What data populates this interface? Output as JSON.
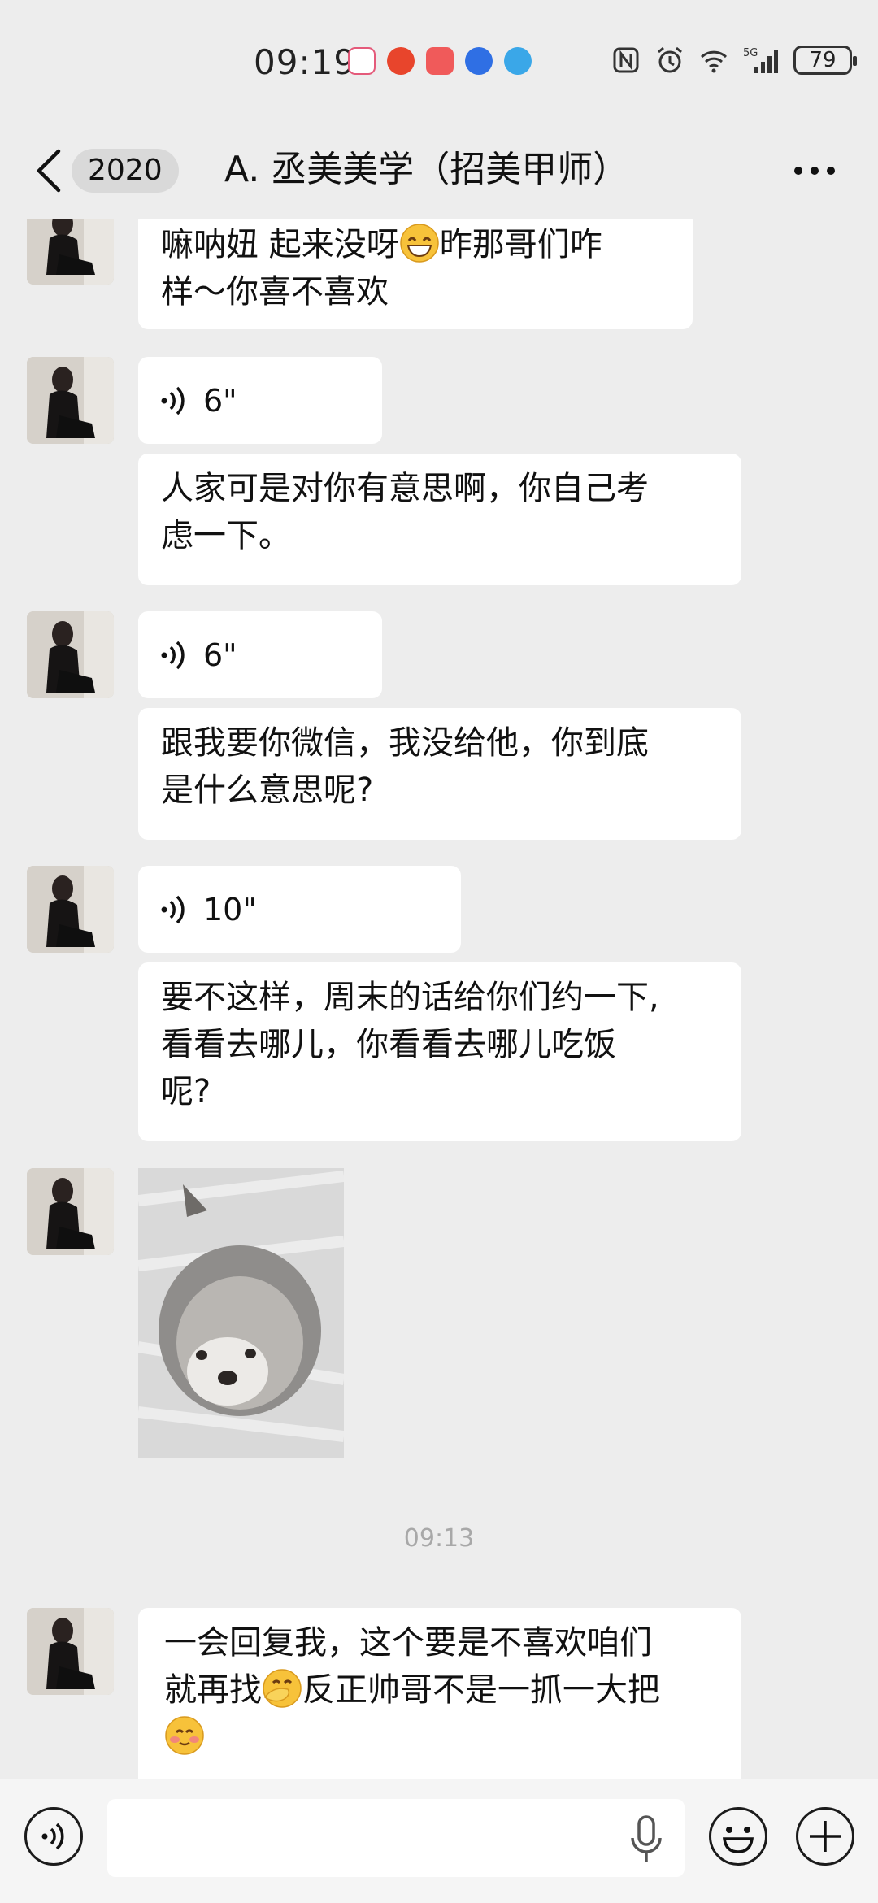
{
  "status_bar": {
    "time": "09:19",
    "battery": "79",
    "network": "5G"
  },
  "header": {
    "back_badge": "2020",
    "title": "A. 丞美美学（招美甲师）"
  },
  "messages": {
    "m1_text": "嘛呐妞 起来没呀😁昨那哥们咋样～你喜不喜欢",
    "m1_line1a": "嘛呐妞 起来没呀",
    "m1_line1b": "昨那哥们咋",
    "m1_line2": "样～你喜不喜欢",
    "v1": "6\"",
    "m2_line1": "人家可是对你有意思啊，你自己考",
    "m2_line2": "虑一下。",
    "v2": "6\"",
    "m3_line1": "跟我要你微信，我没给他，你到底",
    "m3_line2": "是什么意思呢?",
    "v3": "10\"",
    "m4_line1": "要不这样，周末的话给你们约一下,",
    "m4_line2": "看看去哪儿，你看看去哪儿吃饭",
    "m4_line3": "呢?",
    "timestamp": "09:13",
    "m5_line1": "一会回复我，这个要是不喜欢咱们",
    "m5_line2a": "就再找",
    "m5_line2b": "反正帅哥不是一抓一大把"
  },
  "icons": {
    "back": "chevron-left-icon",
    "more": "more-dots-icon",
    "voice": "voice-wave-icon",
    "mic": "microphone-icon",
    "emoji": "emoji-face-icon",
    "plus": "plus-icon"
  }
}
